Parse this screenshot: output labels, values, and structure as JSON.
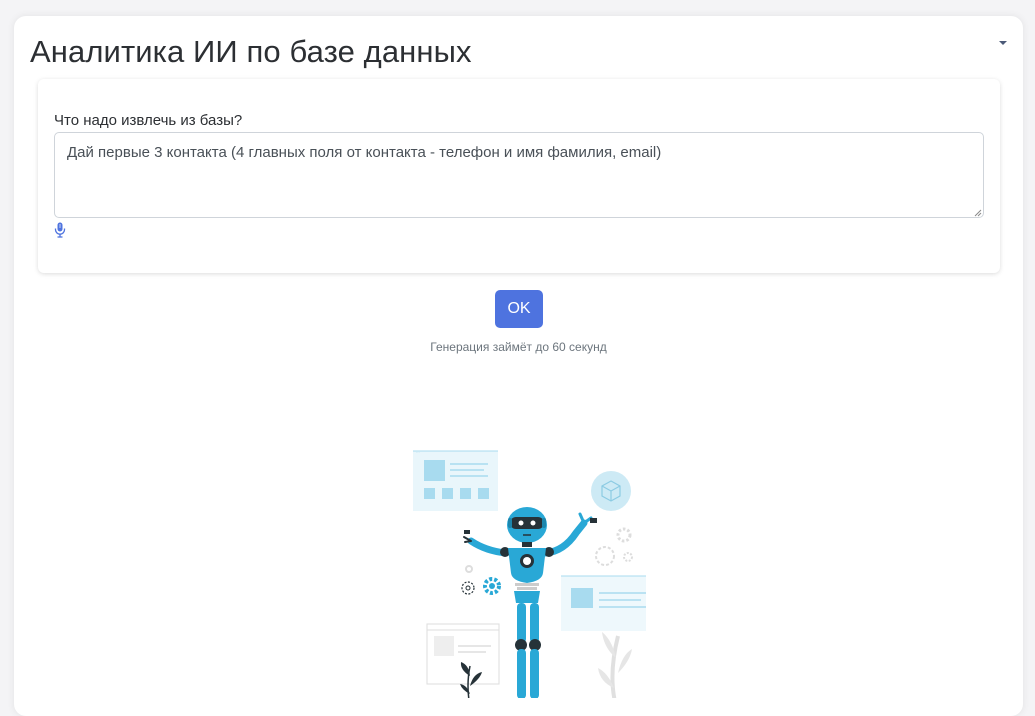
{
  "header": {
    "title": "Аналитика ИИ по базе данных",
    "collapse_icon": "caret-down-icon"
  },
  "query": {
    "label": "Что надо извлечь из базы?",
    "value": "Дай первые 3 контакта (4 главных поля от контакта - телефон и имя фамилия, email)",
    "mic_icon": "microphone-icon"
  },
  "actions": {
    "ok_label": "OK",
    "hint": "Генерация займёт до 60 секунд"
  },
  "illustration": {
    "icon": "robot-illustration"
  },
  "colors": {
    "accent": "#4e73df",
    "robot_blue": "#29a8d6",
    "robot_dark": "#263238",
    "light_blue": "#a8dbef"
  }
}
